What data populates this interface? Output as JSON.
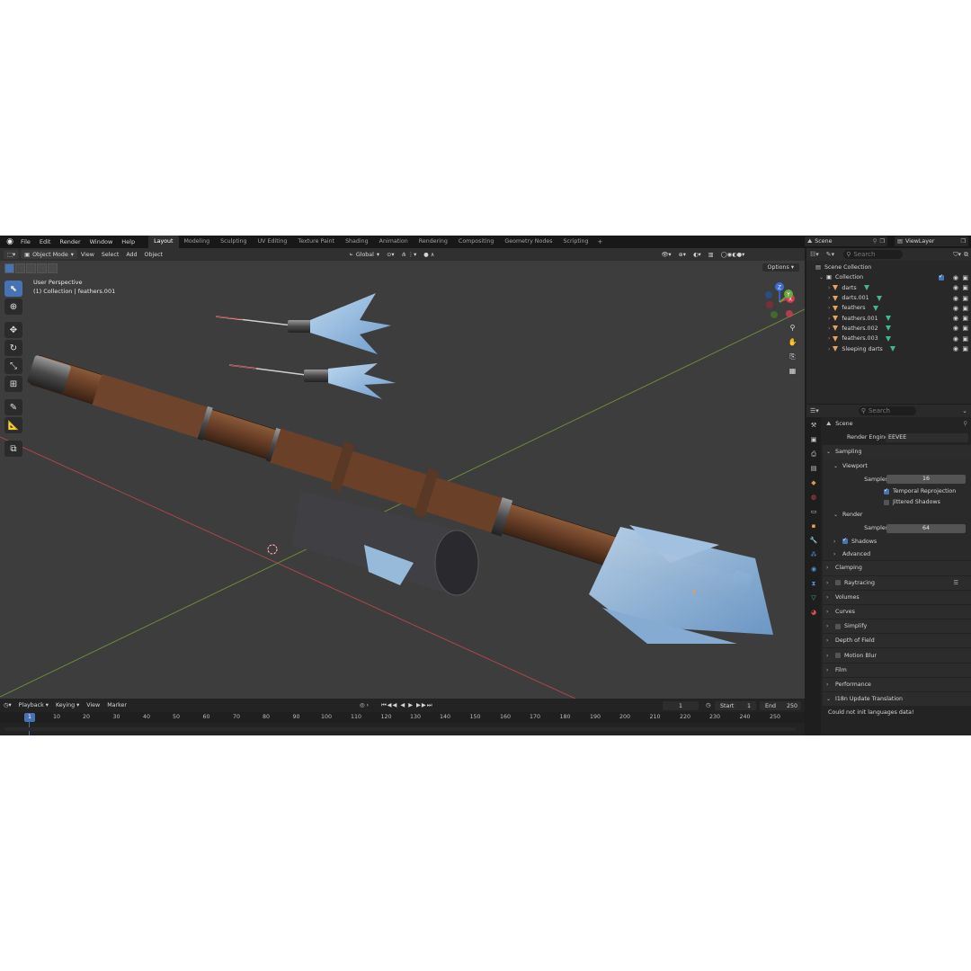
{
  "colors": {
    "accent": "#4772b3",
    "object_icon": "#e8a25a",
    "mesh_icon": "#3fb98a"
  },
  "menu": [
    "File",
    "Edit",
    "Render",
    "Window",
    "Help"
  ],
  "workspaces": [
    "Layout",
    "Modeling",
    "Sculpting",
    "UV Editing",
    "Texture Paint",
    "Shading",
    "Animation",
    "Rendering",
    "Compositing",
    "Geometry Nodes",
    "Scripting"
  ],
  "active_workspace": "Layout",
  "add_workspace": "+",
  "scene_name": "Scene",
  "view_layer": "ViewLayer",
  "viewport": {
    "mode": "Object Mode",
    "menus": [
      "View",
      "Select",
      "Add",
      "Object"
    ],
    "orientation": "Global",
    "options": "Options",
    "info_line1": "User Perspective",
    "info_line2": "(1) Collection | feathers.001",
    "gizmo_axes": {
      "x": "X",
      "y": "Y",
      "z": "Z"
    }
  },
  "timeline": {
    "menus": [
      "Playback",
      "Keying",
      "View",
      "Marker"
    ],
    "current_frame": "1",
    "current_frame_field": "1",
    "start_label": "Start",
    "start_value": "1",
    "end_label": "End",
    "end_value": "250",
    "ticks": [
      "10",
      "20",
      "30",
      "40",
      "50",
      "60",
      "70",
      "80",
      "90",
      "100",
      "110",
      "120",
      "130",
      "140",
      "150",
      "160",
      "170",
      "180",
      "190",
      "200",
      "210",
      "220",
      "230",
      "240",
      "250"
    ]
  },
  "outliner": {
    "search_placeholder": "Search",
    "root": "Scene Collection",
    "collection": "Collection",
    "items": [
      "darts",
      "darts.001",
      "feathers",
      "feathers.001",
      "feathers.002",
      "feathers.003",
      "Sleeping darts"
    ]
  },
  "properties": {
    "search_placeholder": "Search",
    "context": "Scene",
    "render_engine_label": "Render Engine",
    "render_engine_value": "EEVEE",
    "sampling": "Sampling",
    "viewport": "Viewport",
    "viewport_samples_label": "Samples",
    "viewport_samples_value": "16",
    "temporal_reprojection": "Temporal Reprojection",
    "jittered_shadows": "Jittered Shadows",
    "render": "Render",
    "render_samples_label": "Samples",
    "render_samples_value": "64",
    "shadows": "Shadows",
    "advanced": "Advanced",
    "panels": [
      "Clamping",
      "Raytracing",
      "Volumes",
      "Curves",
      "Simplify",
      "Depth of Field",
      "Motion Blur",
      "Film",
      "Performance",
      "I18n Update Translation"
    ],
    "error_message": "Could not init languages data!"
  }
}
